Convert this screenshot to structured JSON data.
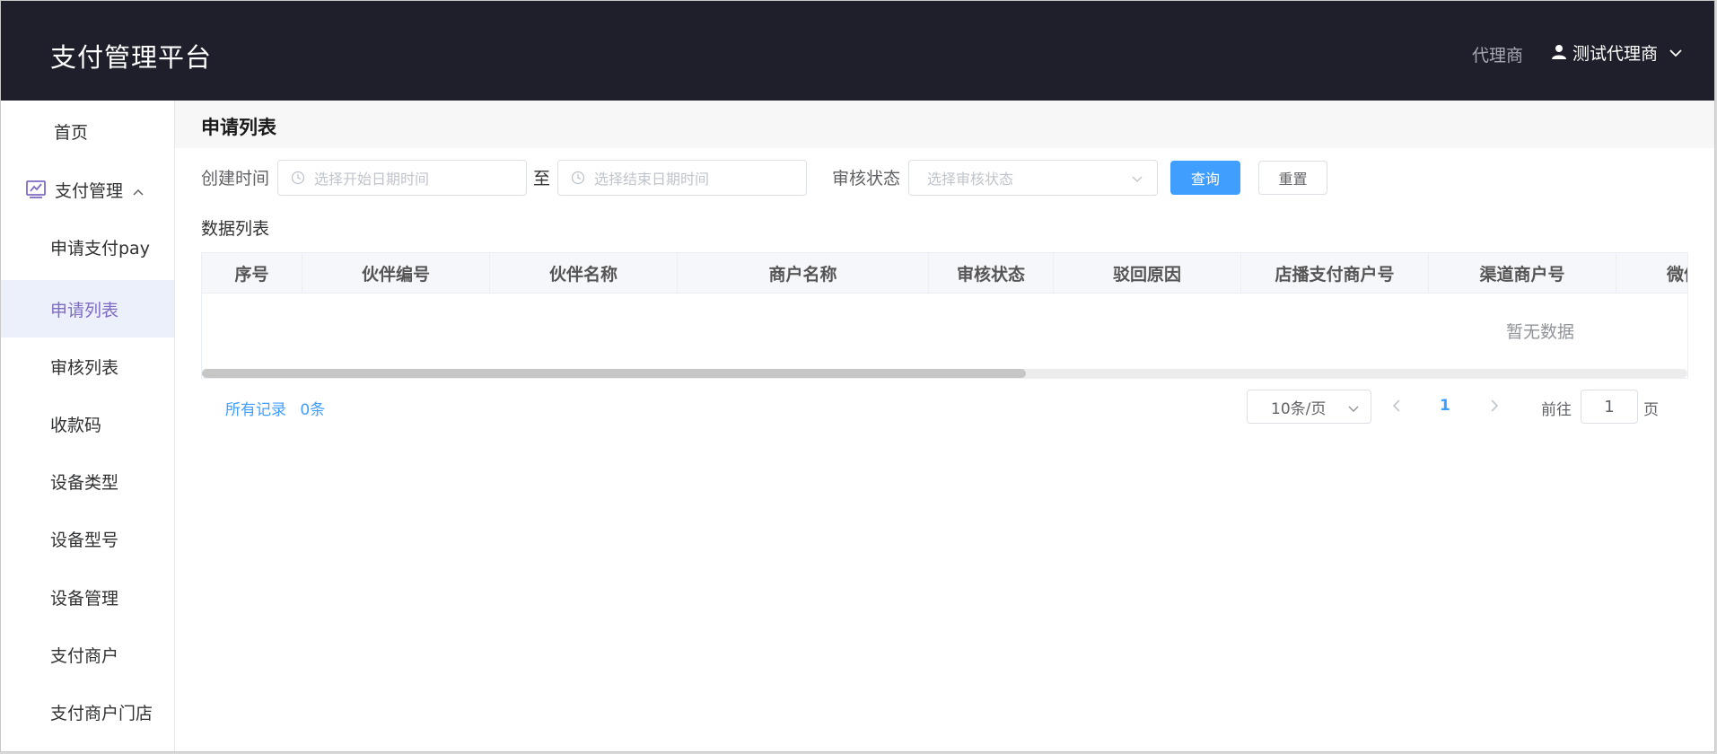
{
  "header": {
    "brand": "支付管理平台",
    "role": "代理商",
    "user_name": "测试代理商"
  },
  "sidebar": {
    "items": [
      {
        "label": "首页"
      },
      {
        "label": "支付管理"
      },
      {
        "label": "申请支付pay"
      },
      {
        "label": "申请列表"
      },
      {
        "label": "审核列表"
      },
      {
        "label": "收款码"
      },
      {
        "label": "设备类型"
      },
      {
        "label": "设备型号"
      },
      {
        "label": "设备管理"
      },
      {
        "label": "支付商户"
      },
      {
        "label": "支付商户门店"
      }
    ]
  },
  "page": {
    "title": "申请列表",
    "filters": {
      "created_label": "创建时间",
      "start_placeholder": "选择开始日期时间",
      "range_sep": "至",
      "end_placeholder": "选择结束日期时间",
      "status_label": "审核状态",
      "status_placeholder": "选择审核状态",
      "query_button": "查询",
      "reset_button": "重置"
    },
    "section_title": "数据列表",
    "table": {
      "columns": [
        "序号",
        "伙伴编号",
        "伙伴名称",
        "商户名称",
        "审核状态",
        "驳回原因",
        "店播支付商户号",
        "渠道商户号",
        "微信"
      ],
      "empty_text": "暂无数据"
    },
    "pagination": {
      "total_label": "所有记录",
      "total_count": "0条",
      "page_size": "10条/页",
      "current_page": "1",
      "goto_label": "前往",
      "goto_value": "1",
      "page_suffix": "页"
    }
  },
  "colors": {
    "header_bg": "#1f1f2c",
    "accent": "#409eff",
    "active_menu_text": "#7f6bc4",
    "active_menu_bg": "#ecf0fb"
  }
}
